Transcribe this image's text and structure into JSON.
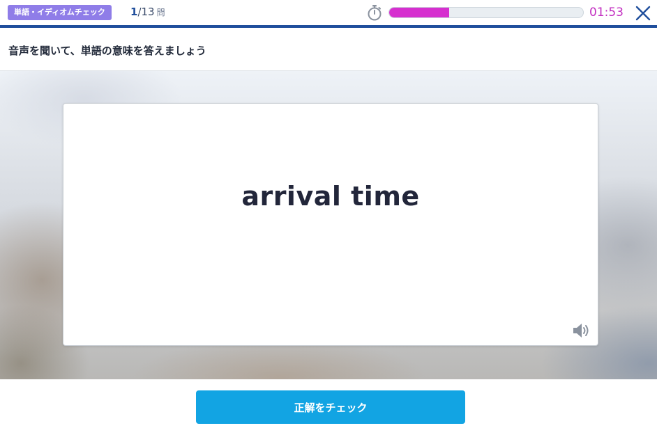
{
  "header": {
    "category_badge": "単語・イディオムチェック",
    "counter_current": "1",
    "counter_total": "/13",
    "counter_unit": "問",
    "timer_icon": "stopwatch-icon",
    "time_progress": 0.31,
    "time_remaining": "01:53",
    "close_icon": "close-icon",
    "accent_color": "#1f4e9c",
    "progress_color": "#d62fcf"
  },
  "instruction": "音声を聞いて、単語の意味を答えましょう",
  "card": {
    "word": "arrival time",
    "audio_icon": "speaker-icon"
  },
  "footer": {
    "check_button_label": "正解をチェック",
    "button_color": "#12a4e3"
  }
}
